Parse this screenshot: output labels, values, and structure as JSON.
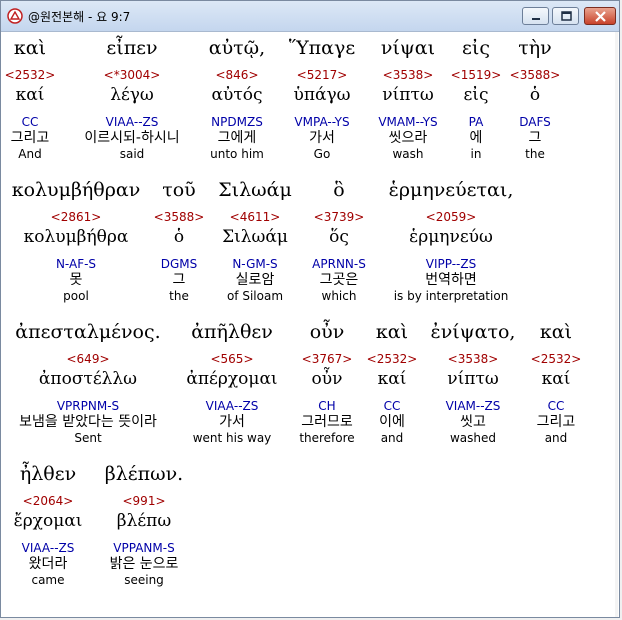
{
  "window": {
    "title": "@원전본해 - 요 9:7"
  },
  "lines": [
    {
      "words": [
        {
          "greek": "καὶ",
          "num": "<2532>",
          "lemma": "καί",
          "parse": "CC",
          "kor": "그리고",
          "eng": "And"
        },
        {
          "greek": "εἶπεν",
          "num": "<*3004>",
          "lemma": "λέγω",
          "parse": "VIAA--ZS",
          "kor": "이르시되-하시니",
          "eng": "said"
        },
        {
          "greek": "αὐτῷ,",
          "num": "<846>",
          "lemma": "αὐτός",
          "parse": "NPDMZS",
          "kor": "그에게",
          "eng": "unto him"
        },
        {
          "greek": "Ὕπαγε",
          "num": "<5217>",
          "lemma": "ὑπάγω",
          "parse": "VMPA--YS",
          "kor": "가서",
          "eng": "Go"
        },
        {
          "greek": "νίψαι",
          "num": "<3538>",
          "lemma": "νίπτω",
          "parse": "VMAM--YS",
          "kor": "씻으라",
          "eng": "wash"
        },
        {
          "greek": "εἰς",
          "num": "<1519>",
          "lemma": "εἰς",
          "parse": "PA",
          "kor": "에",
          "eng": "in"
        },
        {
          "greek": "τὴν",
          "num": "<3588>",
          "lemma": "ὁ",
          "parse": "DAFS",
          "kor": "그",
          "eng": "the"
        }
      ]
    },
    {
      "words": [
        {
          "greek": "κολυμβήθραν",
          "num": "<2861>",
          "lemma": "κολυμβήθρα",
          "parse": "N-AF-S",
          "kor": "못",
          "eng": "pool"
        },
        {
          "greek": "τοῦ",
          "num": "<3588>",
          "lemma": "ὁ",
          "parse": "DGMS",
          "kor": "그",
          "eng": "the"
        },
        {
          "greek": "Σιλωάμ",
          "num": "<4611>",
          "lemma": "Σιλωάμ",
          "parse": "N-GM-S",
          "kor": "실로암",
          "eng": "of Siloam"
        },
        {
          "greek": "ὃ",
          "num": "<3739>",
          "lemma": "ὅς",
          "parse": "APRNN-S",
          "kor": "그곳은",
          "eng": "which"
        },
        {
          "greek": "ἑρμηνεύεται,",
          "num": "<2059>",
          "lemma": "ἑρμηνεύω",
          "parse": "VIPP--ZS",
          "kor": "번역하면",
          "eng": "is by interpretation"
        }
      ]
    },
    {
      "words": [
        {
          "greek": "ἀπεσταλμένος.",
          "num": "<649>",
          "lemma": "ἀποστέλλω",
          "parse": "VPRPNM-S",
          "kor": "보냄을 받았다는 뜻이라",
          "eng": "Sent"
        },
        {
          "greek": "ἀπῆλθεν",
          "num": "<565>",
          "lemma": "ἀπέρχομαι",
          "parse": "VIAA--ZS",
          "kor": "가서",
          "eng": "went his way"
        },
        {
          "greek": "οὖν",
          "num": "<3767>",
          "lemma": "οὖν",
          "parse": "CH",
          "kor": "그러므로",
          "eng": "therefore"
        },
        {
          "greek": "καὶ",
          "num": "<2532>",
          "lemma": "καί",
          "parse": "CC",
          "kor": "이에",
          "eng": "and"
        },
        {
          "greek": "ἐνίψατο,",
          "num": "<3538>",
          "lemma": "νίπτω",
          "parse": "VIAM--ZS",
          "kor": "씻고",
          "eng": "washed"
        },
        {
          "greek": "καὶ",
          "num": "<2532>",
          "lemma": "καί",
          "parse": "CC",
          "kor": "그리고",
          "eng": "and"
        }
      ]
    },
    {
      "words": [
        {
          "greek": "ἦλθεν",
          "num": "<2064>",
          "lemma": "ἔρχομαι",
          "parse": "VIAA--ZS",
          "kor": "왔더라",
          "eng": "came"
        },
        {
          "greek": "βλέπων.",
          "num": "<991>",
          "lemma": "βλέπω",
          "parse": "VPPANM-S",
          "kor": "밝은 눈으로",
          "eng": "seeing"
        }
      ]
    }
  ]
}
